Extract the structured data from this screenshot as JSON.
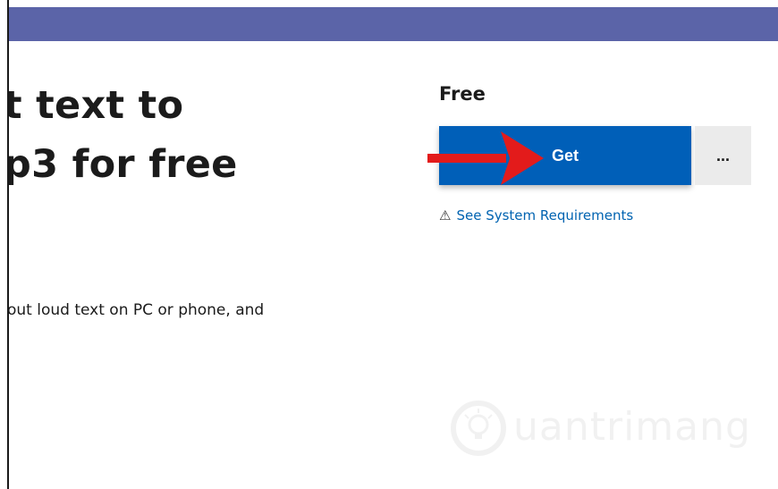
{
  "header": {
    "title_line1": "t text to",
    "title_line2": "p3 for free",
    "description": "out loud text on PC or phone, and"
  },
  "purchase": {
    "price": "Free",
    "get_label": "Get",
    "more_label": "...",
    "system_requirements_label": "See System Requirements",
    "warning_icon": "warning-icon"
  },
  "annotation": {
    "arrow_color": "#e31b1b"
  },
  "watermark": {
    "text": "uantrimang"
  },
  "colors": {
    "top_bar": "#5b64a8",
    "get_button": "#005fb8",
    "link": "#0063b1"
  }
}
